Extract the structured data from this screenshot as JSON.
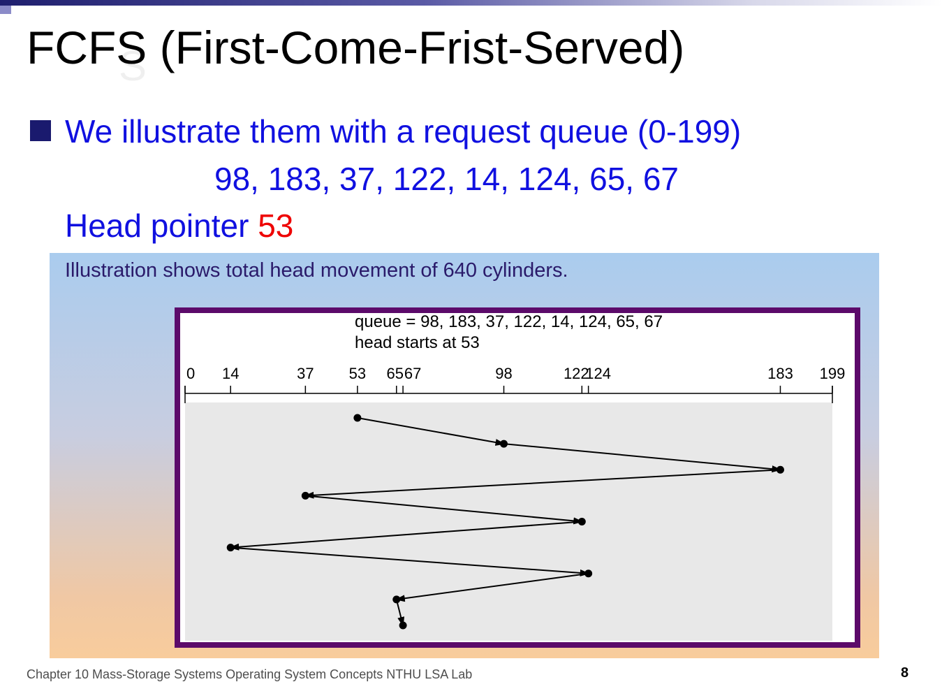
{
  "title": "FCFS (First-Come-Frist-Served)",
  "bullet": {
    "line1": "We illustrate them with a request queue (0-199)",
    "queue": "98, 183, 37, 122, 14, 124, 65, 67",
    "head_label": "Head pointer ",
    "head_value": "53"
  },
  "figure": {
    "caption": "Illustration shows total head movement of 640 cylinders.",
    "queue_text": "queue = 98, 183, 37, 122, 14, 124, 65, 67",
    "head_text": "head starts at 53",
    "axis_ticks": [
      "0",
      "14",
      "37",
      "53",
      "65",
      "67",
      "98",
      "122",
      "124",
      "183",
      "199"
    ],
    "path": [
      53,
      98,
      183,
      37,
      122,
      14,
      124,
      65,
      67
    ],
    "axis_range": [
      0,
      199
    ]
  },
  "colors": {
    "title": "#000000",
    "bullet_text": "#1010e0",
    "head_value": "#ee0000",
    "frame_border": "#5c0a6a",
    "caption": "#2a1a6a"
  },
  "footer": {
    "text": "Chapter 10 Mass-Storage Systems Operating System Concepts NTHU LSA Lab",
    "page": "8"
  }
}
